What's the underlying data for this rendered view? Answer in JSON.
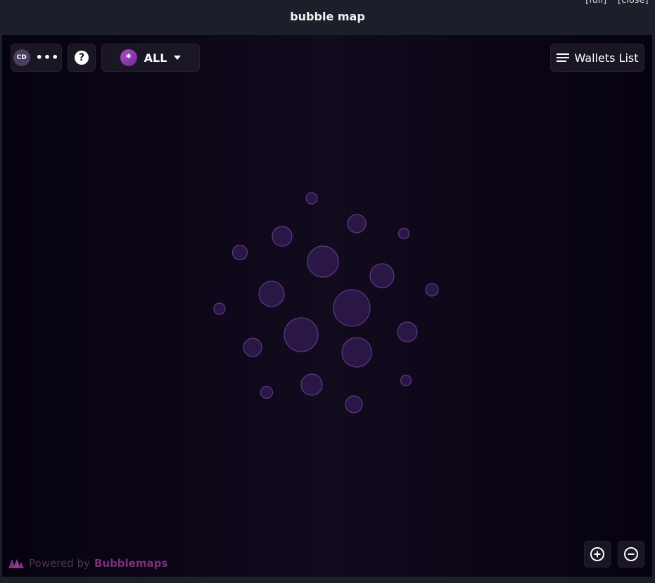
{
  "window": {
    "title": "bubble map",
    "full_label": "[full]",
    "close_label": "[close]"
  },
  "toolbar": {
    "chain_badge": "CD",
    "more_label": "•••",
    "help_label": "?",
    "filter_icon": "*",
    "filter_label": "ALL",
    "wallets_label": "Wallets List"
  },
  "footer": {
    "powered_prefix": "Powered by",
    "powered_brand": "Bubblemaps"
  },
  "icons": {
    "more": "ellipsis-icon",
    "help": "question-icon",
    "filter": "asterisk-icon",
    "dropdown": "caret-down-icon",
    "list": "list-icon",
    "zoom_in": "plus-circle-icon",
    "zoom_out": "minus-circle-icon",
    "logo": "bubblemaps-logo-icon"
  },
  "colors": {
    "bubble_fill": "#2a1745",
    "bubble_stroke": "#5c3b84",
    "brand": "#7a2f7a"
  }
}
